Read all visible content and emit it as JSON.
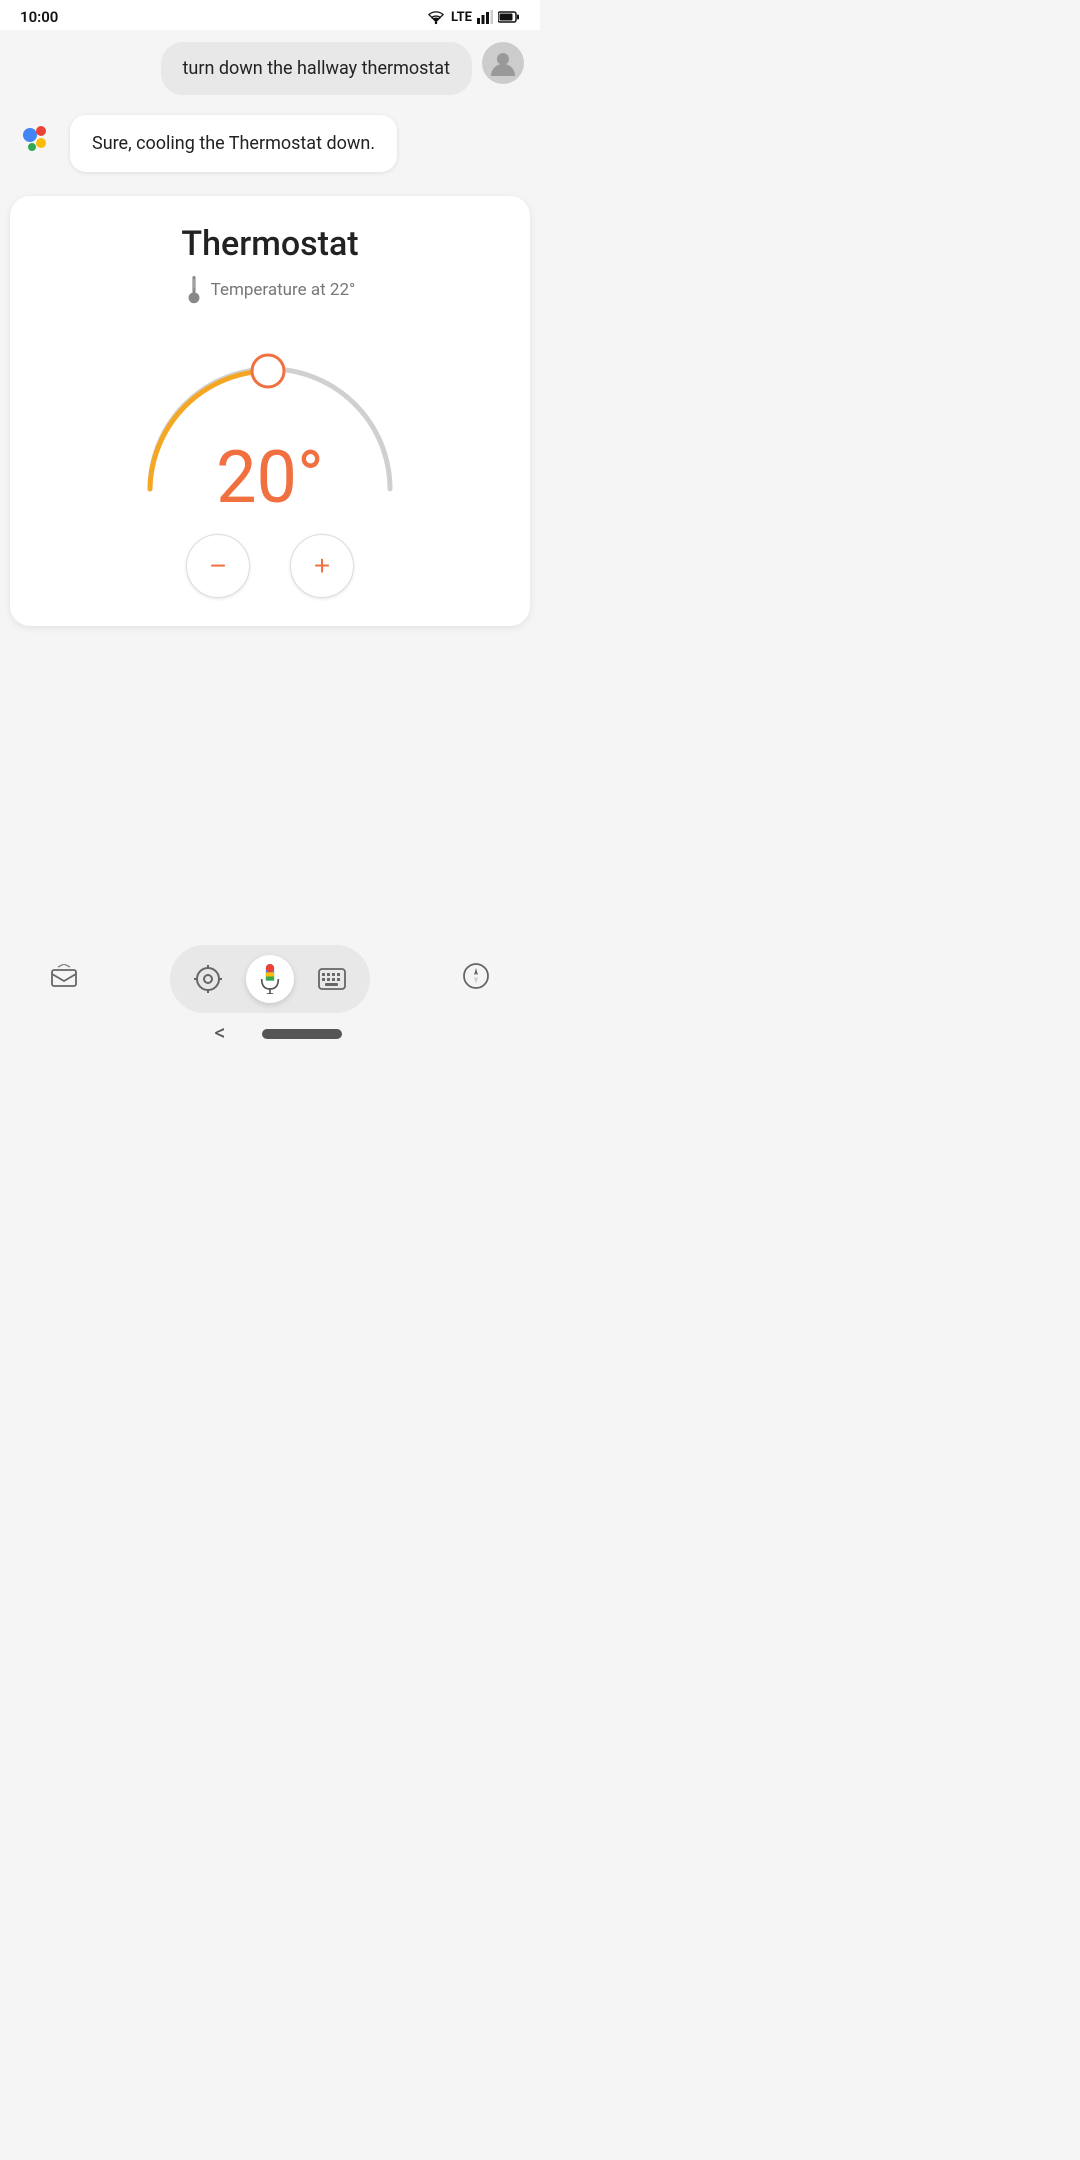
{
  "statusBar": {
    "time": "10:00",
    "wifi": true,
    "lte": true,
    "signal": true,
    "battery": true
  },
  "userMessage": {
    "text": "turn down the hallway thermostat"
  },
  "assistantResponse": {
    "text": "Sure, cooling the Thermostat down."
  },
  "thermostat": {
    "title": "Thermostat",
    "tempLabel": "Temperature at 22°",
    "currentTemp": "20°",
    "colors": {
      "active": "#f5a623",
      "inactive": "#cccccc",
      "handle": "#f07040",
      "tempText": "#f07040"
    }
  },
  "controls": {
    "decrease": "−",
    "increase": "+"
  },
  "navbar": {
    "back": "<"
  }
}
